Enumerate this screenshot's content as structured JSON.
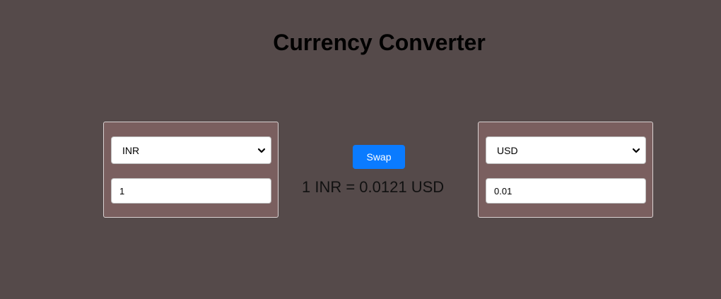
{
  "title": "Currency Converter",
  "from": {
    "currency": "INR",
    "amount": "1"
  },
  "to": {
    "currency": "USD",
    "amount": "0.01"
  },
  "swap_label": "Swap",
  "rate_text": "1 INR = 0.0121 USD",
  "colors": {
    "background": "#554a4a",
    "panel": "#7a5f5f",
    "button": "#0a7bff"
  }
}
